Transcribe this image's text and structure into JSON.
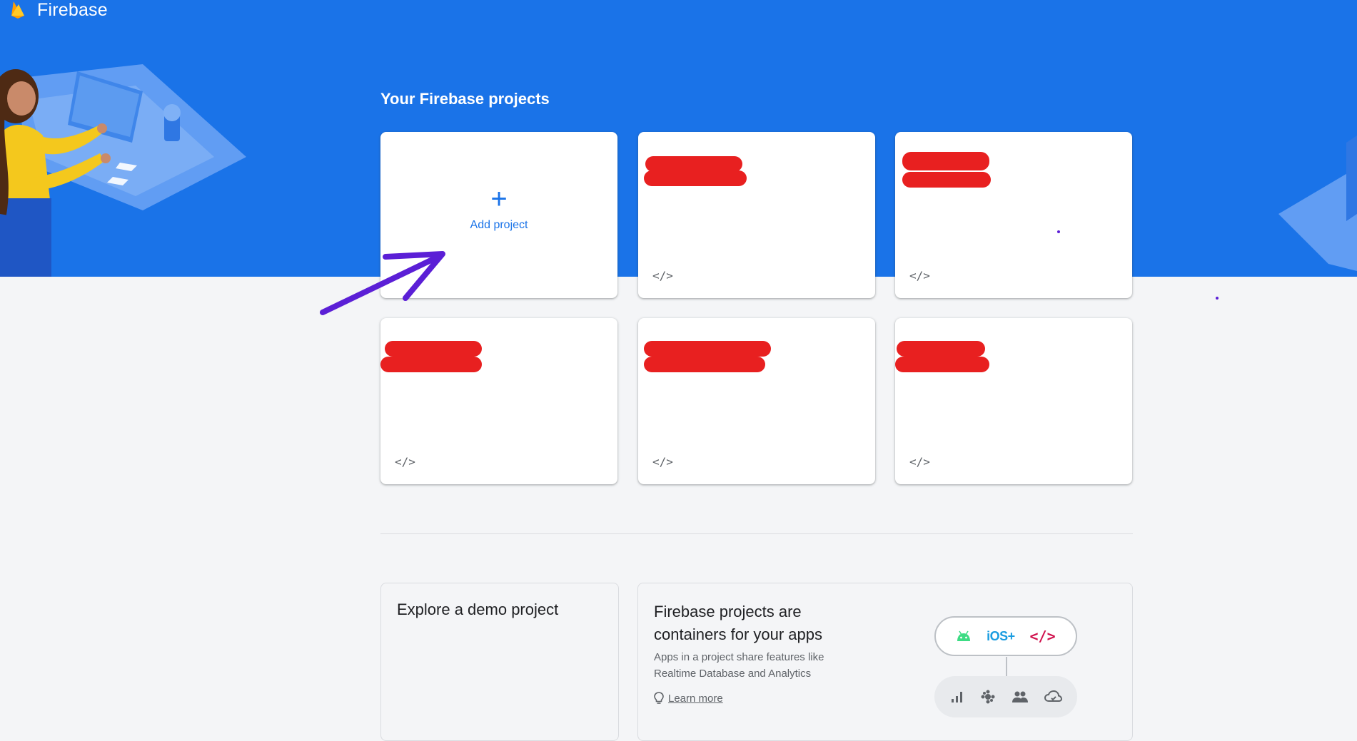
{
  "header": {
    "brand_name": "Firebase",
    "logo_icon": "firebase-flame-icon"
  },
  "projects": {
    "section_title": "Your Firebase projects",
    "add_project": {
      "label": "Add project",
      "icon": "plus-icon"
    },
    "cards": [
      {
        "name": "",
        "app_icon": "code-icon",
        "app_icon_glyph": "</>"
      },
      {
        "name": "",
        "app_icon": "code-icon",
        "app_icon_glyph": "</>"
      },
      {
        "name": "",
        "app_icon": "code-icon",
        "app_icon_glyph": "</>"
      },
      {
        "name": "",
        "app_icon": "code-icon",
        "app_icon_glyph": "</>"
      },
      {
        "name": "",
        "app_icon": "code-icon",
        "app_icon_glyph": "</>"
      }
    ]
  },
  "demo_panel": {
    "title": "Explore a demo project"
  },
  "info_panel": {
    "title": "Firebase projects are containers for your apps",
    "body": "Apps in a project share features like Realtime Database and Analytics",
    "learn_more": "Learn more",
    "platforms": {
      "ios_label": "iOS+",
      "web_label": "</>"
    },
    "feature_icons": [
      "analytics-icon",
      "extensions-icon",
      "users-icon",
      "cloud-icon"
    ]
  },
  "colors": {
    "brand_blue": "#1a73e8",
    "redaction": "#e82020",
    "annotation_arrow": "#5b1fd6",
    "android_green": "#3ddc84",
    "ios_blue": "#1a9ce0",
    "web_red": "#d0104c"
  }
}
